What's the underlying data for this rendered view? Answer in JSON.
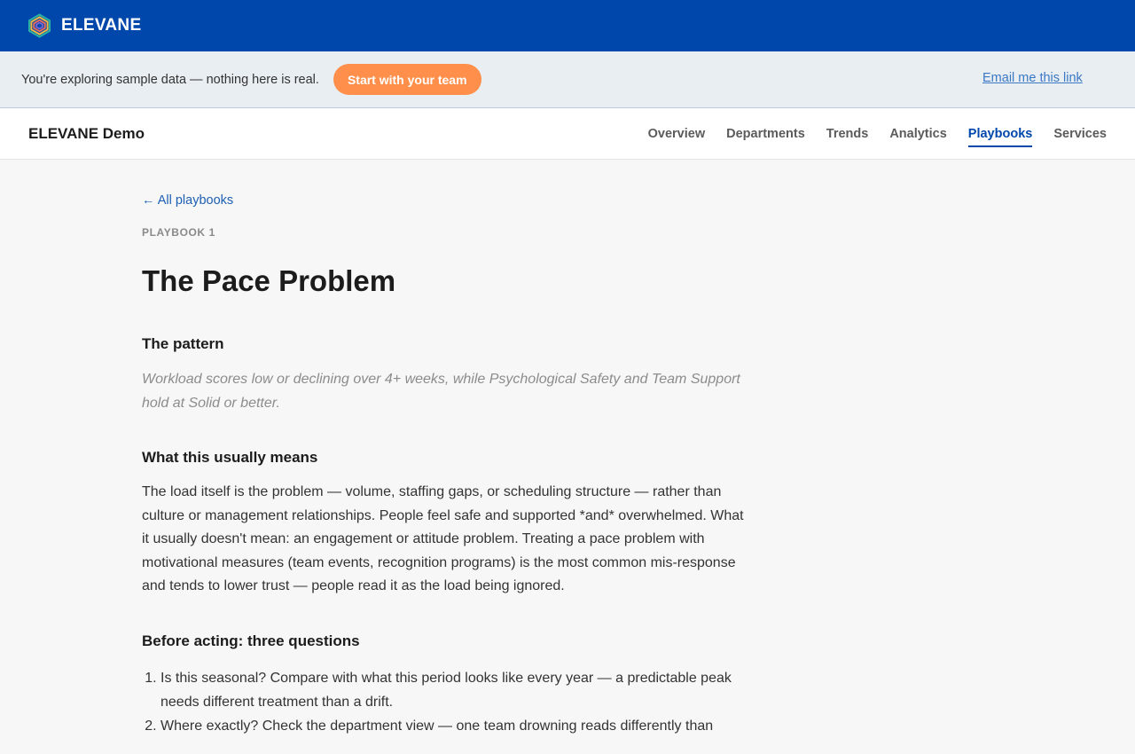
{
  "topbar": {
    "brand": "ELEVANE",
    "logo_icon": "hexagon-logo-icon",
    "background": "#0047ab"
  },
  "banner": {
    "message": "You're exploring sample data — nothing here is real.",
    "cta_label": "Start with your team",
    "cta_color": "#ff8f4a",
    "email_link": "Email me this link"
  },
  "nav": {
    "app_title": "ELEVANE Demo",
    "links": [
      "Overview",
      "Departments",
      "Trends",
      "Analytics",
      "Playbooks",
      "Services"
    ],
    "active": "Playbooks"
  },
  "content": {
    "back_link": "← All playbooks",
    "eyebrow": "PLAYBOOK 1",
    "title": "The Pace Problem",
    "pattern": {
      "heading": "The pattern",
      "text": "Workload scores low or declining over 4+ weeks, while Psychological Safety and Team Support hold at Solid or better."
    },
    "means": {
      "heading": "What this usually means",
      "text": "The load itself is the problem — volume, staffing gaps, or scheduling structure — rather than culture or management relationships. People feel safe and supported *and* overwhelmed. What it usually doesn't mean: an engagement or attitude problem. Treating a pace problem with motivational measures (team events, recognition programs) is the most common mis-response and tends to lower trust — people read it as the load being ignored."
    },
    "before": {
      "heading": "Before acting: three questions",
      "questions": [
        "Is this seasonal? Compare with what this period looks like every year — a predictable peak needs different treatment than a drift.",
        "Where exactly? Check the department view — one team drowning reads differently than"
      ]
    }
  }
}
